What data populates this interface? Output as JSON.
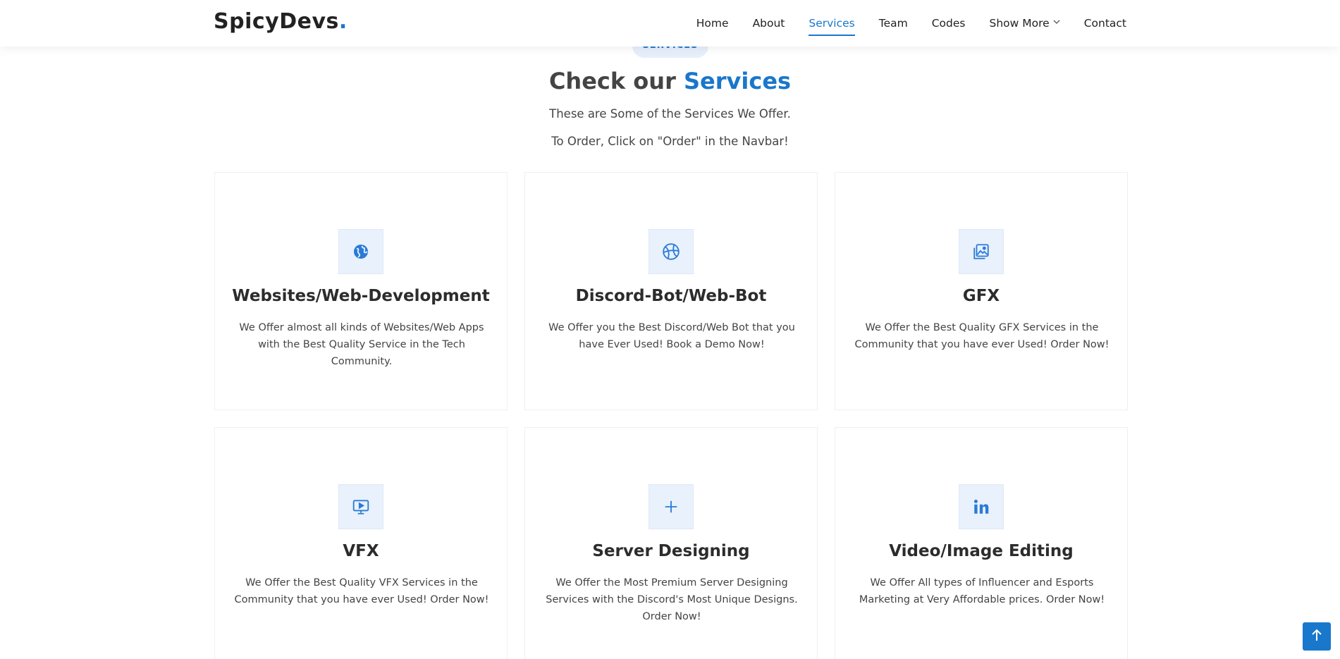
{
  "brand": {
    "name": "SpicyDevs",
    "dot": "."
  },
  "nav": [
    {
      "label": "Home"
    },
    {
      "label": "About"
    },
    {
      "label": "Services",
      "active": true
    },
    {
      "label": "Team"
    },
    {
      "label": "Codes"
    },
    {
      "label": "Show More",
      "dropdown": true
    },
    {
      "label": "Contact"
    }
  ],
  "section": {
    "tag": "SERVICES",
    "title_prefix": "Check our",
    "title_accent": "Services",
    "subtitle1": "These are Some of the Services We Offer.",
    "subtitle2": "To Order, Click on \"Order\" in the Navbar!"
  },
  "services": [
    {
      "icon": "globe-icon",
      "title": "Websites/Web-Development",
      "text": "We Offer almost all kinds of Websites/Web Apps with the Best Quality Service in the Tech Community."
    },
    {
      "icon": "basketball-icon",
      "title": "Discord-Bot/Web-Bot",
      "text": "We Offer you the Best Discord/Web Bot that you have Ever Used! Book a Demo Now!"
    },
    {
      "icon": "images-icon",
      "title": "GFX",
      "text": "We Offer the Best Quality GFX Services in the Community that you have ever Used! Order Now!"
    },
    {
      "icon": "display-play-icon",
      "title": "VFX",
      "text": "We Offer the Best Quality VFX Services in the Community that you have ever Used! Order Now!"
    },
    {
      "icon": "plus-icon",
      "title": "Server Designing",
      "text": "We Offer the Most Premium Server Designing Services with the Discord's Most Unique Designs. Order Now!"
    },
    {
      "icon": "linkedin-icon",
      "title": "Video/Image Editing",
      "text": "We Offer All types of Influencer and Esports Marketing at Very Affordable prices. Order Now!"
    }
  ],
  "colors": {
    "accent": "#1977cc",
    "text": "#444444",
    "heading": "#2c2c2c",
    "icon_bg": "#e9f1fc"
  },
  "back_to_top": {
    "icon": "arrow-up-icon"
  }
}
